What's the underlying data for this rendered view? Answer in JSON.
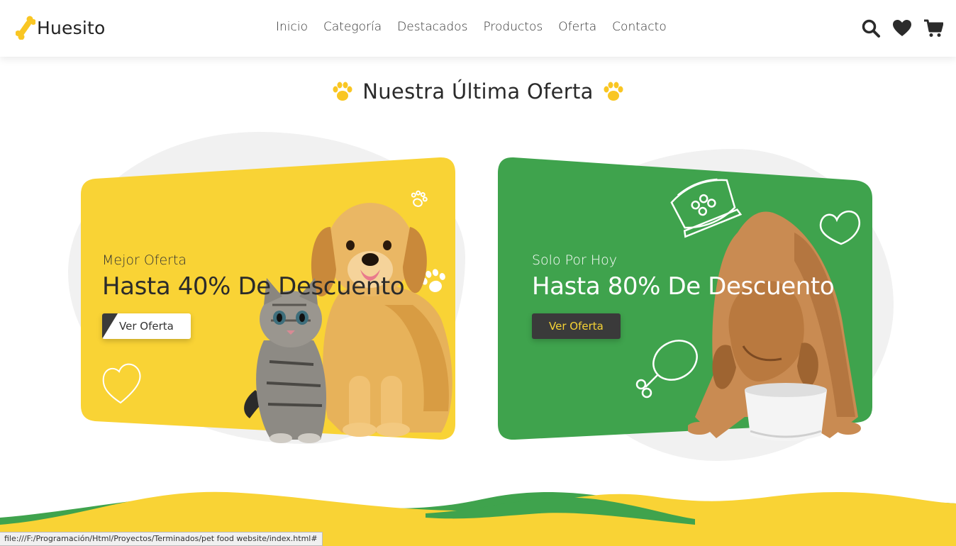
{
  "brand": {
    "name": "Huesito"
  },
  "nav": [
    "Inicio",
    "Categoría",
    "Destacados",
    "Productos",
    "Oferta",
    "Contacto"
  ],
  "header_icons": [
    "search-icon",
    "heart-icon",
    "cart-icon"
  ],
  "section": {
    "title": "Nuestra Última Oferta"
  },
  "offers": [
    {
      "subtitle": "Mejor Oferta",
      "headline": "Hasta 40% De Descuento",
      "button": "Ver Oferta",
      "color": "#f9d335"
    },
    {
      "subtitle": "Solo Por Hoy",
      "headline": "Hasta 80% De Descuento",
      "button": "Ver Oferta",
      "color": "#3fa34d"
    }
  ],
  "colors": {
    "yellow": "#f9d335",
    "green": "#3fa34d",
    "dark": "#3a3a3a"
  },
  "status_bar": "file:///F:/Programación/Html/Proyectos/Terminados/pet food website/index.html#"
}
